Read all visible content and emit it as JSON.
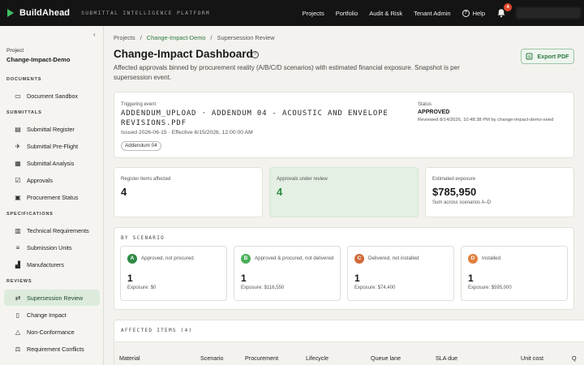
{
  "topbar": {
    "brand": "BuildAhead",
    "subtitle": "SUBMITTAL INTELLIGENCE PLATFORM",
    "nav": [
      "Projects",
      "Portfolio",
      "Audit & Risk",
      "Tenant Admin"
    ],
    "help": "Help",
    "notifications": "4"
  },
  "sidebar": {
    "project_label": "Project",
    "project_name": "Change-Impact-Demo",
    "sections": {
      "documents": "DOCUMENTS",
      "submittals": "SUBMITTALS",
      "specifications": "SPECIFICATIONS",
      "reviews": "REVIEWS"
    },
    "items": {
      "document_sandbox": "Document Sandbox",
      "submittal_register": "Submittal Register",
      "submittal_preflight": "Submittal Pre-Flight",
      "submittal_analysis": "Submittal Analysis",
      "approvals": "Approvals",
      "procurement_status": "Procurement Status",
      "technical_requirements": "Technical Requirements",
      "submission_units": "Submission Units",
      "manufacturers": "Manufacturers",
      "supersession_review": "Supersession Review",
      "change_impact": "Change Impact",
      "non_conformance": "Non-Conformance",
      "requirement_conflicts": "Requirement Conflicts"
    }
  },
  "breadcrumb": [
    "Projects",
    "Change-Impact-Demo",
    "Supersession Review"
  ],
  "page": {
    "title": "Change-Impact Dashboard",
    "subtitle": "Affected approvals binned by procurement reality (A/B/C/D scenarios) with estimated financial exposure. Snapshot is per supersession event.",
    "export_label": "Export PDF"
  },
  "trigger": {
    "label": "Triggering event",
    "name": "ADDENDUM_UPLOAD · ADDENDUM 04 - ACOUSTIC AND ENVELOPE REVISIONS.PDF",
    "meta": "Issued 2026-06-15 · Effective 6/15/2026, 12:00:00 AM",
    "chip": "Addendum 04",
    "status_label": "Status",
    "status": "APPROVED",
    "reviewed": "Reviewed 8/14/2026, 10:48:38 PM by change-impact-demo-seed"
  },
  "stats": {
    "register_label": "Register items affected",
    "register_value": "4",
    "review_label": "Approvals under review",
    "review_value": "4",
    "exposure_label": "Estimated exposure",
    "exposure_value": "$785,950",
    "exposure_sub": "Sum across scenarios A–D"
  },
  "scenarios": {
    "title": "BY SCENARIO",
    "items": [
      {
        "letter": "A",
        "label": "Approved, not procured",
        "count": "1",
        "exposure": "Exposure: $0",
        "color": "#2e8a44"
      },
      {
        "letter": "B",
        "label": "Approved & procured, not delivered",
        "count": "1",
        "exposure": "Exposure: $116,550",
        "color": "#4caf5a"
      },
      {
        "letter": "C",
        "label": "Delivered, not installed",
        "count": "1",
        "exposure": "Exposure: $74,400",
        "color": "#d06a3a"
      },
      {
        "letter": "D",
        "label": "Installed",
        "count": "1",
        "exposure": "Exposure: $595,000",
        "color": "#e0803c"
      }
    ]
  },
  "affected": {
    "title": "AFFECTED ITEMS (4)",
    "columns": [
      "Material",
      "Scenario",
      "Procurement",
      "Lifecycle",
      "Queue lane",
      "SLA due",
      "Unit cost",
      "Q"
    ]
  }
}
